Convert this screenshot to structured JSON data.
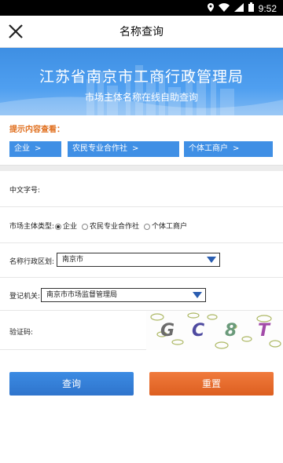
{
  "status": {
    "time": "9:52"
  },
  "header": {
    "title": "名称查询"
  },
  "banner": {
    "title": "江苏省南京市工商行政管理局",
    "subtitle": "市场主体名称在线自助查询"
  },
  "hint": {
    "title": "提示内容查看：",
    "pills": [
      {
        "label": "企业"
      },
      {
        "label": "农民专业合作社"
      },
      {
        "label": "个体工商户"
      }
    ],
    "arrow": ">"
  },
  "form": {
    "chinese_name_label": "中文字号:",
    "entity_type_label": "市场主体类型:",
    "entity_types": [
      "企业",
      "农民专业合作社",
      "个体工商户"
    ],
    "entity_type_selected": "企业",
    "region_label": "名称行政区划:",
    "region_value": "南京市",
    "authority_label": "登记机关:",
    "authority_value": "南京市市场监督管理局",
    "captcha_label": "验证码:",
    "captcha_text": [
      "G",
      "C",
      "8",
      "T"
    ]
  },
  "buttons": {
    "query": "查询",
    "reset": "重置"
  },
  "colors": {
    "accent_blue": "#3f8fe5",
    "reset_orange": "#e86a2c",
    "hint_orange": "#e07020"
  }
}
